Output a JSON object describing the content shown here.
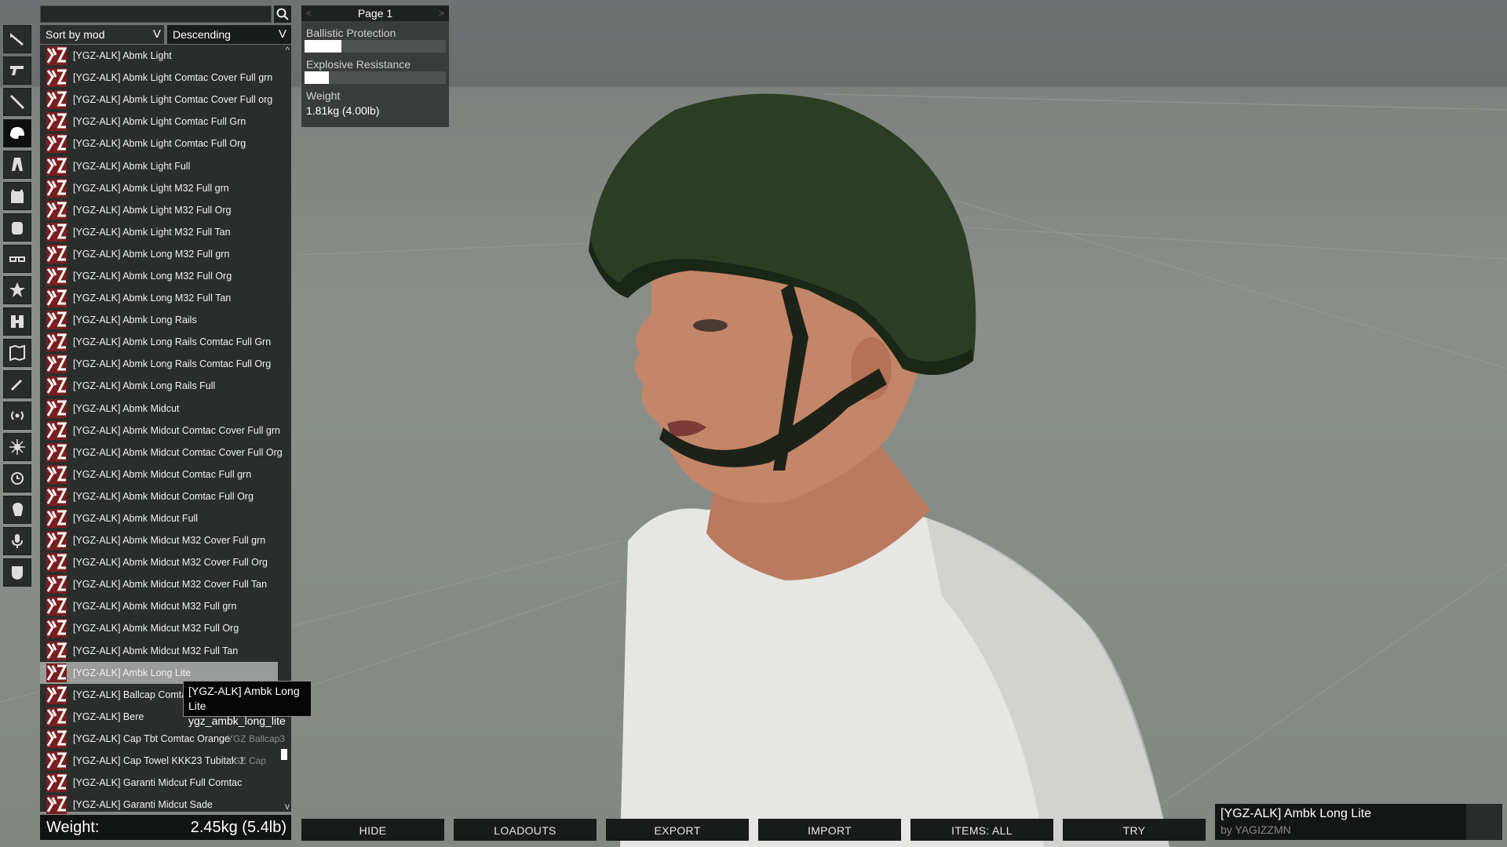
{
  "search": {
    "value": "",
    "placeholder": ""
  },
  "sort": {
    "field": "Sort by mod",
    "order": "Descending",
    "arrow": "V"
  },
  "categories": [
    {
      "icon": "rifle-icon"
    },
    {
      "icon": "pistol-icon"
    },
    {
      "icon": "launcher-icon"
    },
    {
      "icon": "helmet-icon",
      "active": true
    },
    {
      "icon": "uniform-icon"
    },
    {
      "icon": "vest-icon"
    },
    {
      "icon": "backpack-icon"
    },
    {
      "icon": "goggles-icon"
    },
    {
      "icon": "insignia-icon"
    },
    {
      "icon": "binoculars-icon"
    },
    {
      "icon": "map-icon"
    },
    {
      "icon": "gps-icon"
    },
    {
      "icon": "radio-icon"
    },
    {
      "icon": "compass-icon"
    },
    {
      "icon": "watch-icon"
    },
    {
      "icon": "face-icon"
    },
    {
      "icon": "microphone-icon"
    },
    {
      "icon": "shield-icon"
    }
  ],
  "items": [
    {
      "label": "[YGZ-ALK] Abmk Light",
      "mod": ""
    },
    {
      "label": "[YGZ-ALK] Abmk Light Comtac Cover Full grn",
      "mod": ""
    },
    {
      "label": "[YGZ-ALK] Abmk Light Comtac Cover Full org",
      "mod": ""
    },
    {
      "label": "[YGZ-ALK] Abmk Light Comtac Full Grn",
      "mod": ""
    },
    {
      "label": "[YGZ-ALK] Abmk Light Comtac Full Org",
      "mod": ""
    },
    {
      "label": "[YGZ-ALK] Abmk Light Full",
      "mod": ""
    },
    {
      "label": "[YGZ-ALK] Abmk Light M32 Full grn",
      "mod": ""
    },
    {
      "label": "[YGZ-ALK] Abmk Light M32 Full Org",
      "mod": ""
    },
    {
      "label": "[YGZ-ALK] Abmk Light M32 Full Tan",
      "mod": ""
    },
    {
      "label": "[YGZ-ALK] Abmk Long M32 Full grn",
      "mod": ""
    },
    {
      "label": "[YGZ-ALK] Abmk Long M32 Full Org",
      "mod": ""
    },
    {
      "label": "[YGZ-ALK] Abmk Long M32 Full Tan",
      "mod": ""
    },
    {
      "label": "[YGZ-ALK] Abmk Long Rails",
      "mod": ""
    },
    {
      "label": "[YGZ-ALK] Abmk Long Rails Comtac Full Grn",
      "mod": ""
    },
    {
      "label": "[YGZ-ALK] Abmk Long Rails Comtac Full Org",
      "mod": ""
    },
    {
      "label": "[YGZ-ALK] Abmk Long Rails Full",
      "mod": ""
    },
    {
      "label": "[YGZ-ALK] Abmk Midcut",
      "mod": ""
    },
    {
      "label": "[YGZ-ALK] Abmk Midcut Comtac Cover Full grn",
      "mod": ""
    },
    {
      "label": "[YGZ-ALK] Abmk Midcut Comtac Cover Full Org",
      "mod": ""
    },
    {
      "label": "[YGZ-ALK] Abmk Midcut Comtac Full grn",
      "mod": ""
    },
    {
      "label": "[YGZ-ALK] Abmk Midcut Comtac Full Org",
      "mod": ""
    },
    {
      "label": "[YGZ-ALK] Abmk Midcut Full",
      "mod": ""
    },
    {
      "label": "[YGZ-ALK] Abmk Midcut M32 Cover Full grn",
      "mod": ""
    },
    {
      "label": "[YGZ-ALK] Abmk Midcut M32 Cover Full Org",
      "mod": ""
    },
    {
      "label": "[YGZ-ALK] Abmk Midcut M32 Cover Full Tan",
      "mod": ""
    },
    {
      "label": "[YGZ-ALK] Abmk Midcut M32 Full grn",
      "mod": ""
    },
    {
      "label": "[YGZ-ALK] Abmk Midcut M32 Full Org",
      "mod": ""
    },
    {
      "label": "[YGZ-ALK] Abmk Midcut M32 Full Tan",
      "mod": ""
    },
    {
      "label": "[YGZ-ALK] Ambk Long Lite",
      "mod": "",
      "selected": true
    },
    {
      "label": "[YGZ-ALK] Ballcap Comtac G",
      "mod": ""
    },
    {
      "label": "[YGZ-ALK] Bere",
      "mod": ""
    },
    {
      "label": "[YGZ-ALK] Cap Tbt Comtac Orange",
      "mod": "YGZ Ballcap3"
    },
    {
      "label": "[YGZ-ALK] Cap Towel KKK23 Tubitak 1",
      "mod": "YGZ Cap"
    },
    {
      "label": "[YGZ-ALK] Garanti Midcut Full Comtac",
      "mod": ""
    },
    {
      "label": "[YGZ-ALK] Garanti Midcut Sade",
      "mod": ""
    }
  ],
  "scroll": {
    "up": "^",
    "down": "v"
  },
  "tooltip": {
    "name": "[YGZ-ALK] Ambk Long Lite",
    "classname": "ygz_ambk_long_lite"
  },
  "stats": {
    "page": "Page 1",
    "prev": "<",
    "next": ">",
    "ballistic_label": "Ballistic Protection",
    "ballistic_level": 0.26,
    "explosive_label": "Explosive Resistance",
    "explosive_level": 0.17,
    "weight_label": "Weight",
    "weight_value": "1.81kg (4.00lb)"
  },
  "total_weight": {
    "label": "Weight:",
    "value": "2.45kg (5.4lb)"
  },
  "buttons": [
    "HIDE",
    "LOADOUTS",
    "EXPORT",
    "IMPORT",
    "ITEMS: ALL",
    "TRY"
  ],
  "selected_info": {
    "title": "[YGZ-ALK] Ambk Long Lite",
    "author": "by YAGIZZMN"
  },
  "colors": {
    "helmet": "#2b3e24",
    "panel": "#2b2d2d",
    "selected_row": "#9a9b9b",
    "button": "#191a1a"
  }
}
